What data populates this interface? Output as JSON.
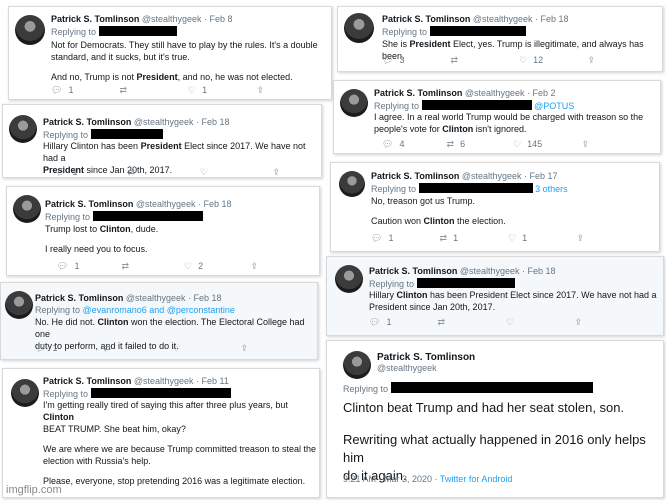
{
  "tweets": [
    {
      "name": "Patrick S. Tomlinson",
      "handle": "@stealthygeek",
      "date": "Feb 8",
      "replying": "Replying to",
      "p1a": "Not for Democrats. They still have to play by the rules. It's a double",
      "p1b": "standard, and it sucks, but it's true.",
      "p2a": "And no, Trump is not ",
      "p2b": "President",
      "p2c": ", and no, he was not elected.",
      "reply": "1",
      "rt": "",
      "like": "1"
    },
    {
      "name": "Patrick S. Tomlinson",
      "handle": "@stealthygeek",
      "date": "Feb 18",
      "replying": "Replying to",
      "a": "She is ",
      "b": "President",
      "c": " Elect, yes. Trump is illegitimate, and always has been.",
      "reply": "3",
      "rt": "",
      "like": "12"
    },
    {
      "name": "Patrick S. Tomlinson",
      "handle": "@stealthygeek",
      "date": "Feb 2",
      "replying": "Replying to",
      "mention": "@POTUS",
      "l1": "I agree. In a real world Trump would be charged with treason so the",
      "l2a": "people's vote for ",
      "l2b": "Clinton",
      "l2c": " isn't ignored.",
      "reply": "4",
      "rt": "6",
      "like": "145"
    },
    {
      "name": "Patrick S. Tomlinson",
      "handle": "@stealthygeek",
      "date": "Feb 18",
      "replying": "Replying to",
      "l1a": "Hillary Clinton has been ",
      "l1b": "President",
      "l1c": " Elect since 2017. We have not had a",
      "l2a": "President",
      "l2b": " since Jan 20th, 2017.",
      "reply": "1",
      "rt": "",
      "like": ""
    },
    {
      "name": "Patrick S. Tomlinson",
      "handle": "@stealthygeek",
      "date": "Feb 17",
      "replying": "Replying to",
      "others": "3 others",
      "l1": "No, treason got us Trump.",
      "l2a": "Caution won ",
      "l2b": "Clinton",
      "l2c": " the election.",
      "reply": "1",
      "rt": "1",
      "like": "1"
    },
    {
      "name": "Patrick S. Tomlinson",
      "handle": "@stealthygeek",
      "date": "Feb 18",
      "replying": "Replying to",
      "l1a": "Trump lost to ",
      "l1b": "Clinton",
      "l1c": ", dude.",
      "l2": "I really need you to focus.",
      "reply": "1",
      "rt": "",
      "like": "2"
    },
    {
      "name": "Patrick S. Tomlinson",
      "handle": "@stealthygeek",
      "date": "Feb 18",
      "replying": "Replying to",
      "l1a": "Hillary ",
      "l1b": "Clinton",
      "l1c": " has been President Elect since 2017. We have not had a",
      "l2": "President since Jan 20th, 2017.",
      "reply": "1",
      "rt": "",
      "like": ""
    },
    {
      "name": "Patrick S. Tomlinson",
      "handle": "@stealthygeek",
      "date": "Feb 18",
      "replying": "Replying to",
      "mentions": "@evanromano6 and @perconstantine",
      "l1a": "No. He did not. ",
      "l1b": "Clinton",
      "l1c": " won the election. The Electoral College had one",
      "l2": "duty to perform, and it failed to do it.",
      "reply": "1",
      "rt": "",
      "like": ""
    },
    {
      "name": "Patrick S. Tomlinson",
      "handle": "@stealthygeek",
      "date": "Feb 11",
      "replying": "Replying to",
      "l1a": "I'm getting really tired of saying this after three plus years, but ",
      "l1b": "Clinton",
      "l2": " BEAT TRUMP. She beat him, okay?",
      "l3": "We are where we are because Trump committed treason to steal the",
      "l4": "election with Russia's help.",
      "l5": "Please, everyone, stop pretending 2016 was a legitimate election."
    },
    {
      "name": "Patrick S. Tomlinson",
      "handle": "@stealthygeek",
      "replying": "Replying to",
      "l1": "Clinton beat Trump and had her seat stolen, son.",
      "l2": "Rewriting what actually happened in 2016 only helps him",
      "l3": "do it again.",
      "time": "9:21 AM · Mar 3, 2020 · ",
      "source": "Twitter for Android"
    }
  ],
  "watermark": "imgflip.com"
}
